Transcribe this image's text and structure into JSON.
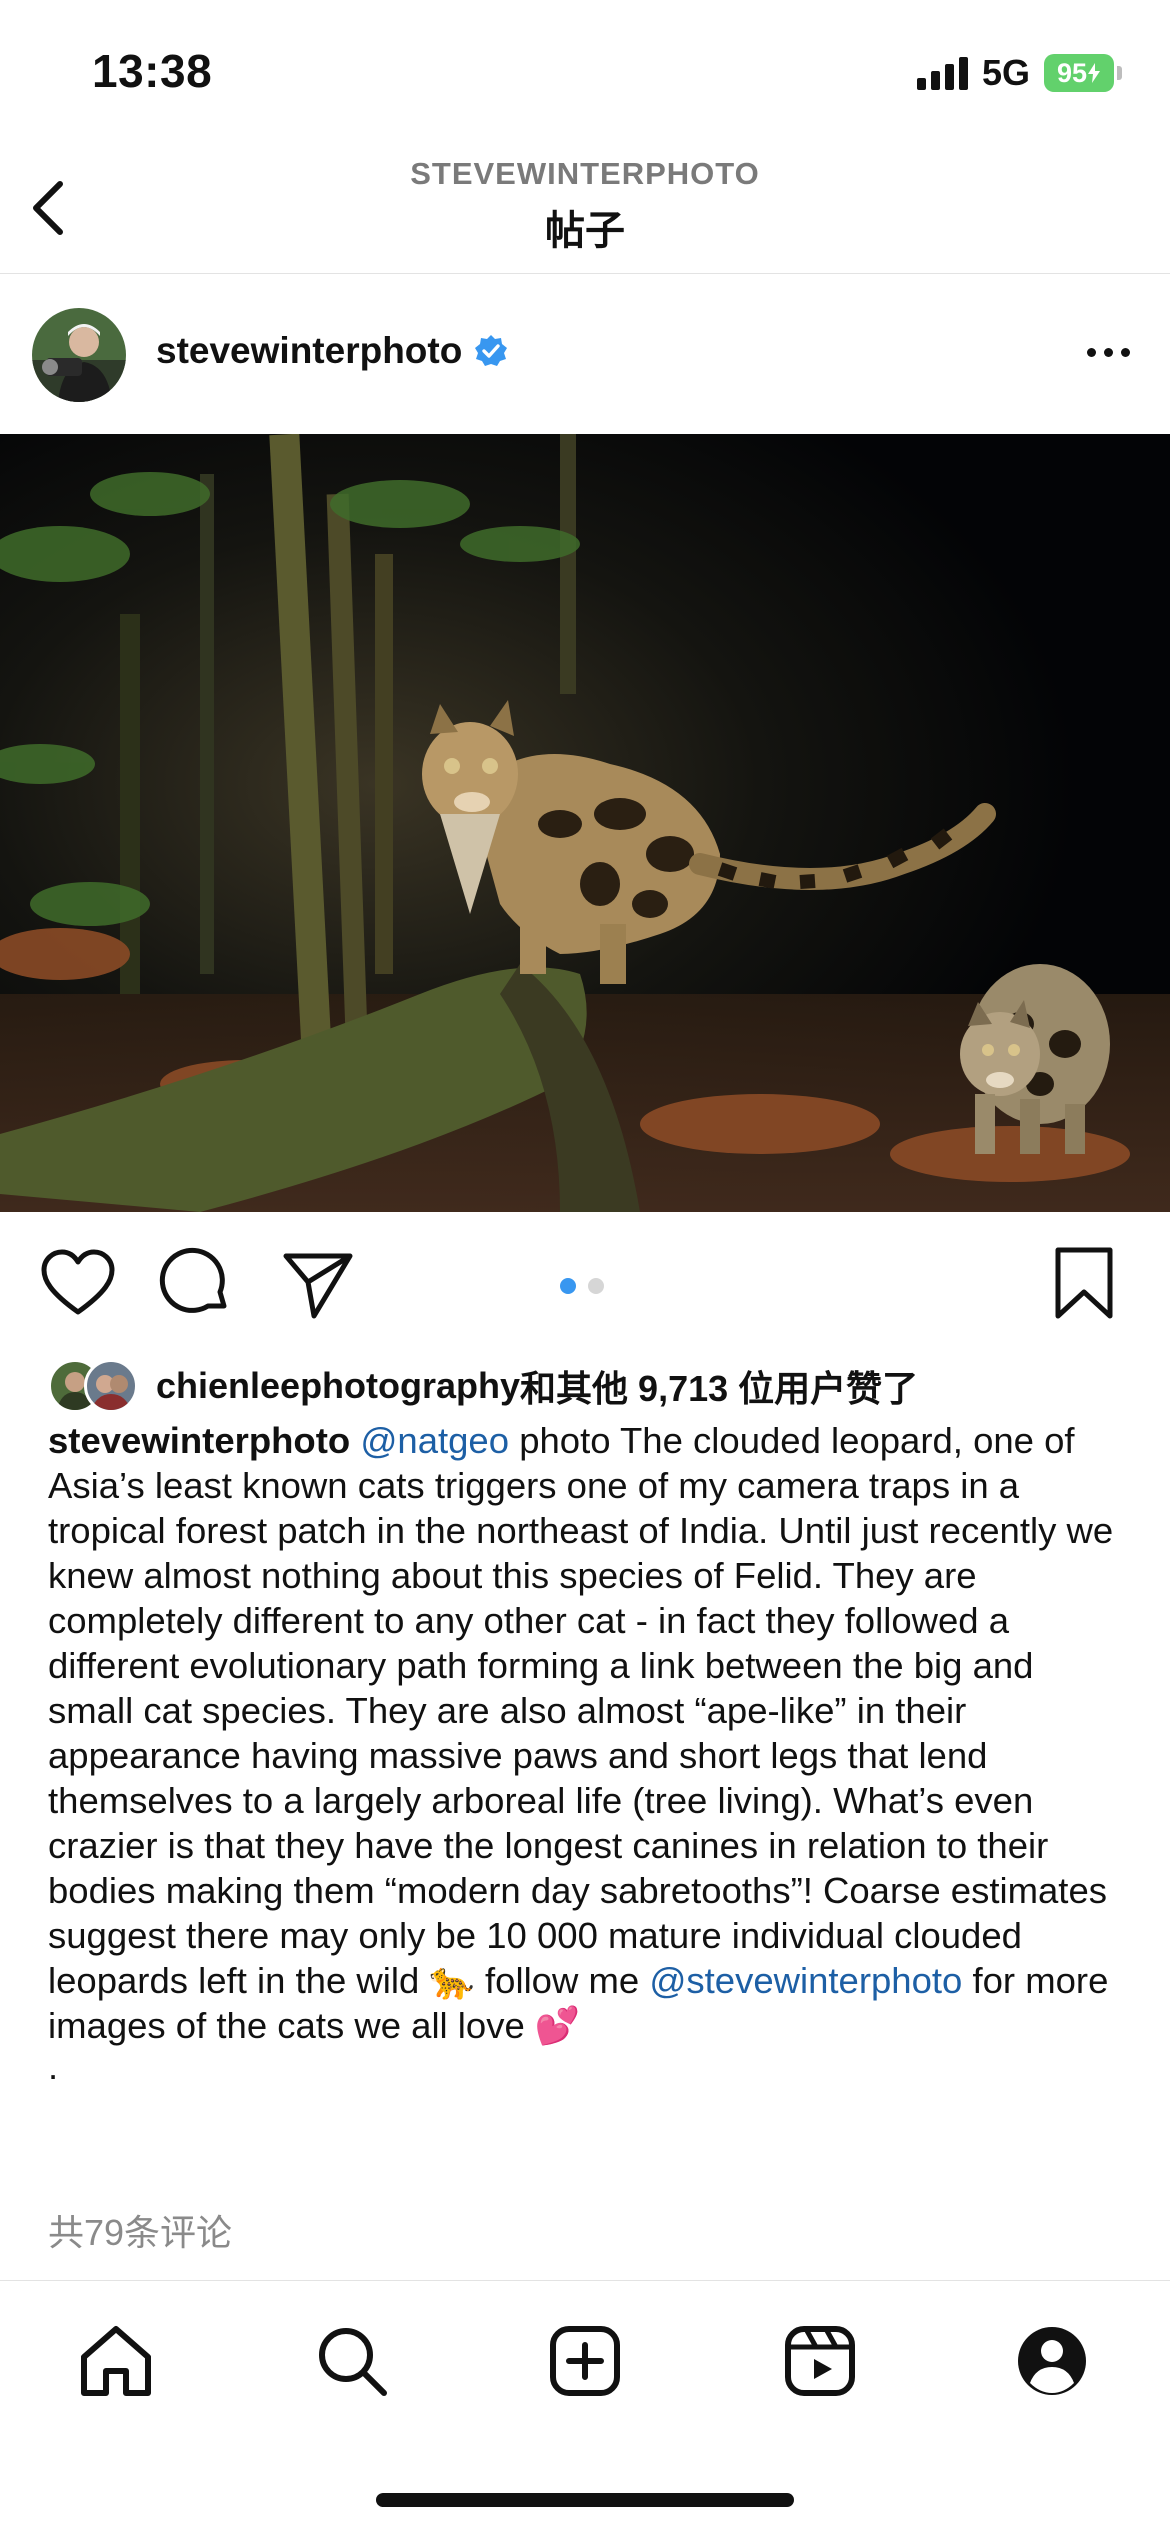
{
  "status_bar": {
    "time": "13:38",
    "network": "5G",
    "battery": "95"
  },
  "header": {
    "account": "STEVEWINTERPHOTO",
    "title": "帖子"
  },
  "post": {
    "username": "stevewinterphoto",
    "verified": true,
    "carousel": {
      "count": 2,
      "active": 0
    },
    "likes": {
      "liker": "chienleephotography",
      "rest": "和其他 9,713 位用户赞了"
    },
    "caption": {
      "username": "stevewinterphoto",
      "mention1": "@natgeo",
      "text1": " photo The clouded leopard, one of Asia’s least known cats triggers one of my camera traps in a tropical forest patch in the northeast of India. Until just recently we knew almost nothing about this species of Felid. They are completely different to any other cat - in fact they followed a different evolutionary path forming a link between the big and small cat species. They are also almost “ape-like” in their appearance having massive paws and short legs that lend themselves to a largely arboreal life (tree living). What’s even crazier is that they have the longest canines in relation to their bodies making them “modern day sabretooths”! Coarse estimates suggest there may only be 10 000 mature individual clouded leopards left in the wild 🐆 follow me ",
      "mention2": "@stevewinterphoto",
      "text2": " for more images of the cats we all love 💕",
      "trailer": "."
    },
    "comments_label": "共79条评论"
  },
  "icons": {
    "back": "chevron-left-icon",
    "verified": "verified-badge-icon",
    "more": "more-horizontal-icon",
    "like": "heart-icon",
    "comment": "comment-bubble-icon",
    "share": "paper-plane-icon",
    "save": "bookmark-icon",
    "tabs": [
      "home-icon",
      "search-icon",
      "create-post-icon",
      "reels-icon",
      "profile-icon"
    ]
  },
  "colors": {
    "battery": "#62d16c",
    "verified": "#3897f0",
    "link": "#1d5fa5",
    "carousel_active": "#3897f0",
    "carousel_inactive": "#d6d6d6"
  }
}
